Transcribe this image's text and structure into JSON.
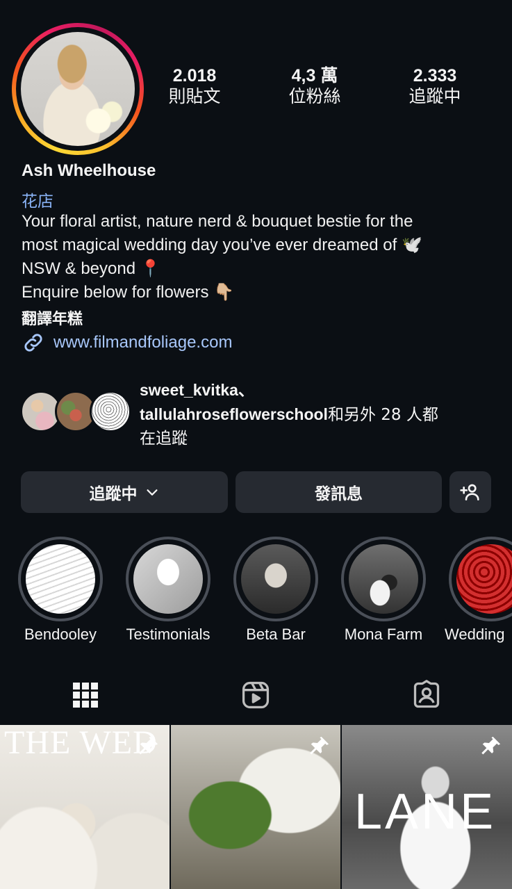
{
  "profile": {
    "name": "Ash Wheelhouse",
    "category": "花店",
    "bio": [
      "Your floral artist, nature nerd & bouquet bestie for the",
      "most magical wedding day you’ve ever dreamed of 🕊️",
      "NSW & beyond 📍",
      "Enquire below for flowers 👇🏼"
    ],
    "translate_label": "翻譯年糕",
    "link": "www.filmandfoliage.com"
  },
  "stats": [
    {
      "count": "2.018",
      "label": "則貼文"
    },
    {
      "count": "4,3 萬",
      "label": "位粉絲"
    },
    {
      "count": "2.333",
      "label": "追蹤中"
    }
  ],
  "followed_by": {
    "accounts": "sweet_kvitka、",
    "account2": "tallulahroseflowerschool",
    "suffix": "和另外 28 人都",
    "suffix2": "在追蹤"
  },
  "buttons": {
    "following": "追蹤中",
    "message": "發訊息"
  },
  "highlights": [
    {
      "label": "Bendooley"
    },
    {
      "label": "Testimonials"
    },
    {
      "label": "Beta Bar"
    },
    {
      "label": "Mona Farm"
    },
    {
      "label": "Wedding"
    }
  ],
  "posts": [
    {
      "overlay_text": "THE WED"
    },
    {
      "overlay_text": ""
    },
    {
      "overlay_text": "LANE"
    }
  ],
  "colors": {
    "background": "#0b0f14",
    "link": "#a8c7fa",
    "category": "#8ab4f8",
    "button": "#262a31"
  },
  "icons": {
    "grid_tab": "grid-icon",
    "reels_tab": "reels-icon",
    "tagged_tab": "tagged-icon",
    "link": "link-icon",
    "pin": "pin-icon",
    "add_user": "add-user-icon"
  }
}
